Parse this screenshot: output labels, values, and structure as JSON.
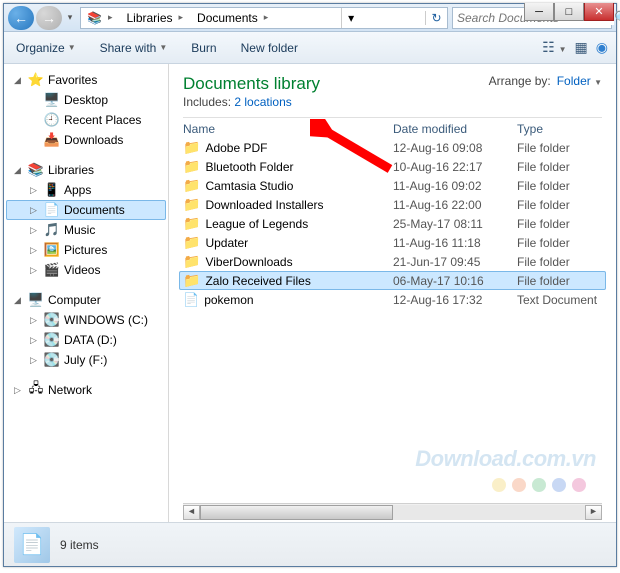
{
  "breadcrumb": {
    "root_icon": "📚",
    "items": [
      "Libraries",
      "Documents"
    ]
  },
  "search": {
    "placeholder": "Search Documents"
  },
  "toolbar": {
    "organize": "Organize",
    "share": "Share with",
    "burn": "Burn",
    "newfolder": "New folder"
  },
  "tree": {
    "favorites": {
      "label": "Favorites",
      "items": [
        "Desktop",
        "Recent Places",
        "Downloads"
      ]
    },
    "libraries": {
      "label": "Libraries",
      "items": [
        "Apps",
        "Documents",
        "Music",
        "Pictures",
        "Videos"
      ],
      "selected": "Documents"
    },
    "computer": {
      "label": "Computer",
      "items": [
        "WINDOWS (C:)",
        "DATA (D:)",
        "July (F:)"
      ]
    },
    "network": {
      "label": "Network"
    }
  },
  "library": {
    "title": "Documents library",
    "includes_label": "Includes:",
    "includes_link": "2 locations",
    "arrange_label": "Arrange by:",
    "arrange_value": "Folder"
  },
  "columns": {
    "name": "Name",
    "date": "Date modified",
    "type": "Type"
  },
  "files": [
    {
      "name": "Adobe PDF",
      "date": "12-Aug-16 09:08",
      "type": "File folder",
      "kind": "folder"
    },
    {
      "name": "Bluetooth Folder",
      "date": "10-Aug-16 22:17",
      "type": "File folder",
      "kind": "folder"
    },
    {
      "name": "Camtasia Studio",
      "date": "11-Aug-16 09:02",
      "type": "File folder",
      "kind": "folder"
    },
    {
      "name": "Downloaded Installers",
      "date": "11-Aug-16 22:00",
      "type": "File folder",
      "kind": "folder"
    },
    {
      "name": "League of Legends",
      "date": "25-May-17 08:11",
      "type": "File folder",
      "kind": "folder"
    },
    {
      "name": "Updater",
      "date": "11-Aug-16 11:18",
      "type": "File folder",
      "kind": "folder"
    },
    {
      "name": "ViberDownloads",
      "date": "21-Jun-17 09:45",
      "type": "File folder",
      "kind": "folder"
    },
    {
      "name": "Zalo Received Files",
      "date": "06-May-17 10:16",
      "type": "File folder",
      "kind": "folder",
      "selected": true
    },
    {
      "name": "pokemon",
      "date": "12-Aug-16 17:32",
      "type": "Text Document",
      "kind": "doc"
    }
  ],
  "status": {
    "count": "9 items"
  },
  "watermark": "Download.com.vn",
  "dot_colors": [
    "#f0d060",
    "#f09060",
    "#60c080",
    "#6090e0",
    "#e060a0"
  ]
}
